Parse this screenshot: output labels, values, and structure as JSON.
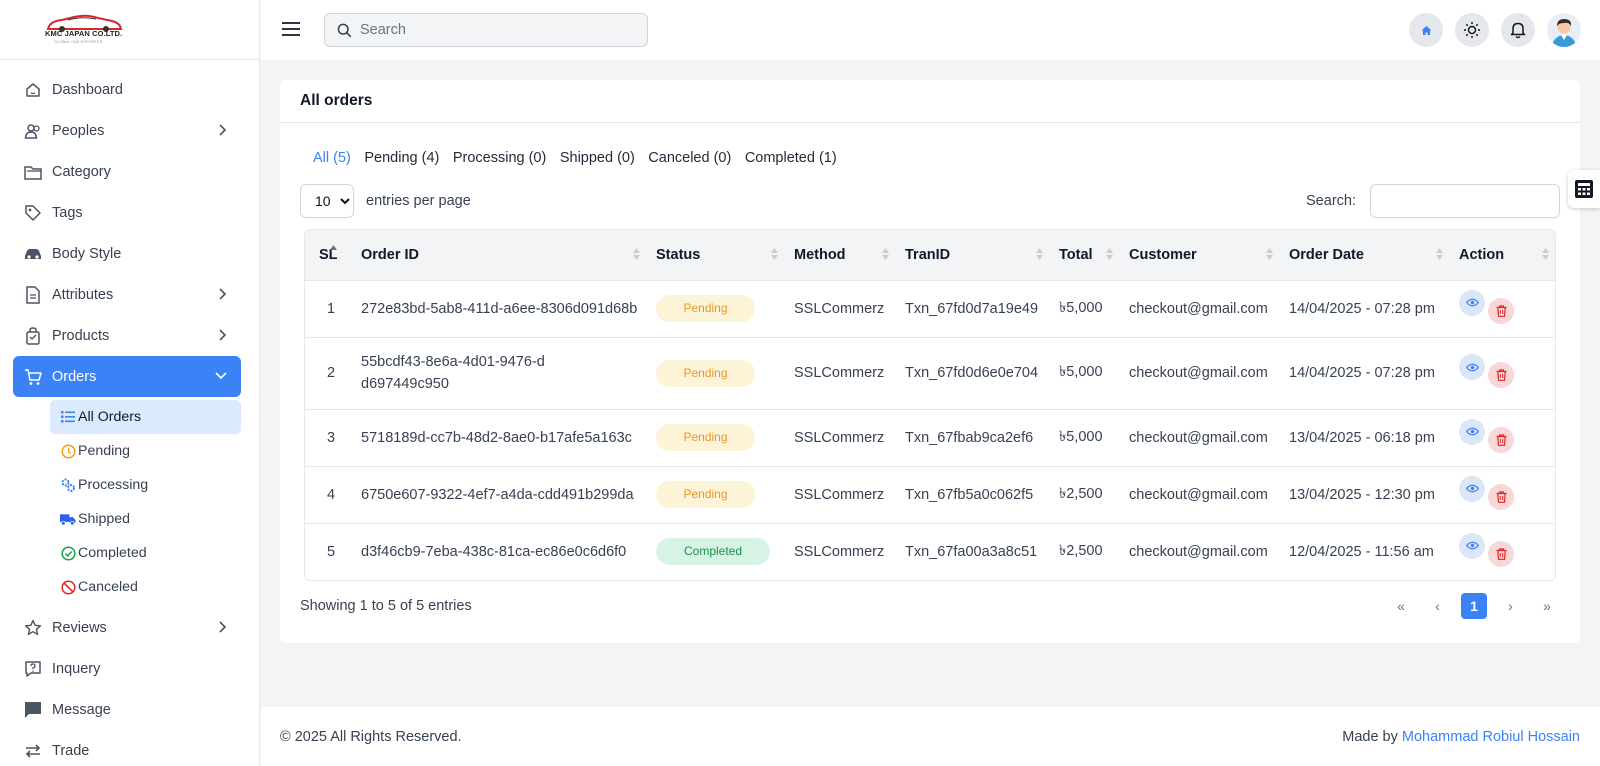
{
  "brand": {
    "name": "KMC JAPAN CO.LTD.",
    "tagline": "GLOBAL CAR EXPORTER"
  },
  "sidebar": {
    "items": [
      {
        "label": "Dashboard",
        "icon": "dashboard-icon"
      },
      {
        "label": "Peoples",
        "icon": "users-icon"
      },
      {
        "label": "Category",
        "icon": "folder-icon"
      },
      {
        "label": "Tags",
        "icon": "tag-icon"
      },
      {
        "label": "Body Style",
        "icon": "car-icon"
      },
      {
        "label": "Attributes",
        "icon": "document-icon"
      },
      {
        "label": "Products",
        "icon": "bag-icon"
      },
      {
        "label": "Orders",
        "icon": "cart-icon"
      },
      {
        "label": "Reviews",
        "icon": "star-icon"
      },
      {
        "label": "Inquery",
        "icon": "question-icon"
      },
      {
        "label": "Message",
        "icon": "message-icon"
      },
      {
        "label": "Trade",
        "icon": "exchange-icon"
      }
    ],
    "orders_sub": [
      {
        "label": "All Orders",
        "color": "#3b82f6"
      },
      {
        "label": "Pending",
        "color": "#f59e0b"
      },
      {
        "label": "Processing",
        "color": "#3b82f6"
      },
      {
        "label": "Shipped",
        "color": "#2563eb"
      },
      {
        "label": "Completed",
        "color": "#16a34a"
      },
      {
        "label": "Canceled",
        "color": "#dc2626"
      }
    ]
  },
  "topbar": {
    "search_placeholder": "Search"
  },
  "page": {
    "title": "All orders",
    "tabs": [
      "All (5)",
      "Pending (4)",
      "Processing (0)",
      "Shipped (0)",
      "Canceled (0)",
      "Completed (1)"
    ],
    "per_page": "10",
    "per_page_label": "entries per page",
    "search_label": "Search:",
    "columns": [
      "SL",
      "Order ID",
      "Status",
      "Method",
      "TranID",
      "Total",
      "Customer",
      "Order Date",
      "Action"
    ],
    "rows": [
      {
        "sl": "1",
        "order_id": "272e83bd-5ab8-411d-a6ee-8306d091d68b",
        "status": "Pending",
        "method": "SSLCommerz",
        "tran_id": "Txn_67fd0d7a19e49",
        "total": "৳5,000",
        "customer": "checkout@gmail.com",
        "date": "14/04/2025 - 07:28 pm"
      },
      {
        "sl": "2",
        "order_id": "55bcdf43-8e6a-4d01-9476-dd697449c950",
        "status": "Pending",
        "method": "SSLCommerz",
        "tran_id": "Txn_67fd0d6e0e704",
        "total": "৳5,000",
        "customer": "checkout@gmail.com",
        "date": "14/04/2025 - 07:28 pm"
      },
      {
        "sl": "3",
        "order_id": "5718189d-cc7b-48d2-8ae0-b17afe5a163c",
        "status": "Pending",
        "method": "SSLCommerz",
        "tran_id": "Txn_67fbab9ca2ef6",
        "total": "৳5,000",
        "customer": "checkout@gmail.com",
        "date": "13/04/2025 - 06:18 pm"
      },
      {
        "sl": "4",
        "order_id": "6750e607-9322-4ef7-a4da-cdd491b299da",
        "status": "Pending",
        "method": "SSLCommerz",
        "tran_id": "Txn_67fb5a0c062f5",
        "total": "৳2,500",
        "customer": "checkout@gmail.com",
        "date": "13/04/2025 - 12:30 pm"
      },
      {
        "sl": "5",
        "order_id": "d3f46cb9-7eba-438c-81ca-ec86e0c6d6f0",
        "status": "Completed",
        "method": "SSLCommerz",
        "tran_id": "Txn_67fa00a3a8c51",
        "total": "৳2,500",
        "customer": "checkout@gmail.com",
        "date": "12/04/2025 - 11:56 am"
      }
    ],
    "showing": "Showing 1 to 5 of 5 entries",
    "pager": {
      "first": "«",
      "prev": "‹",
      "current": "1",
      "next": "›",
      "last": "»"
    }
  },
  "footer": {
    "copyright": "© 2025 All Rights Reserved.",
    "made_by": "Made by",
    "author": "Mohammad Robiul Hossain"
  },
  "colors": {
    "accent": "#3b82f6",
    "pending": "#e39a2b",
    "completed": "#18924f"
  }
}
